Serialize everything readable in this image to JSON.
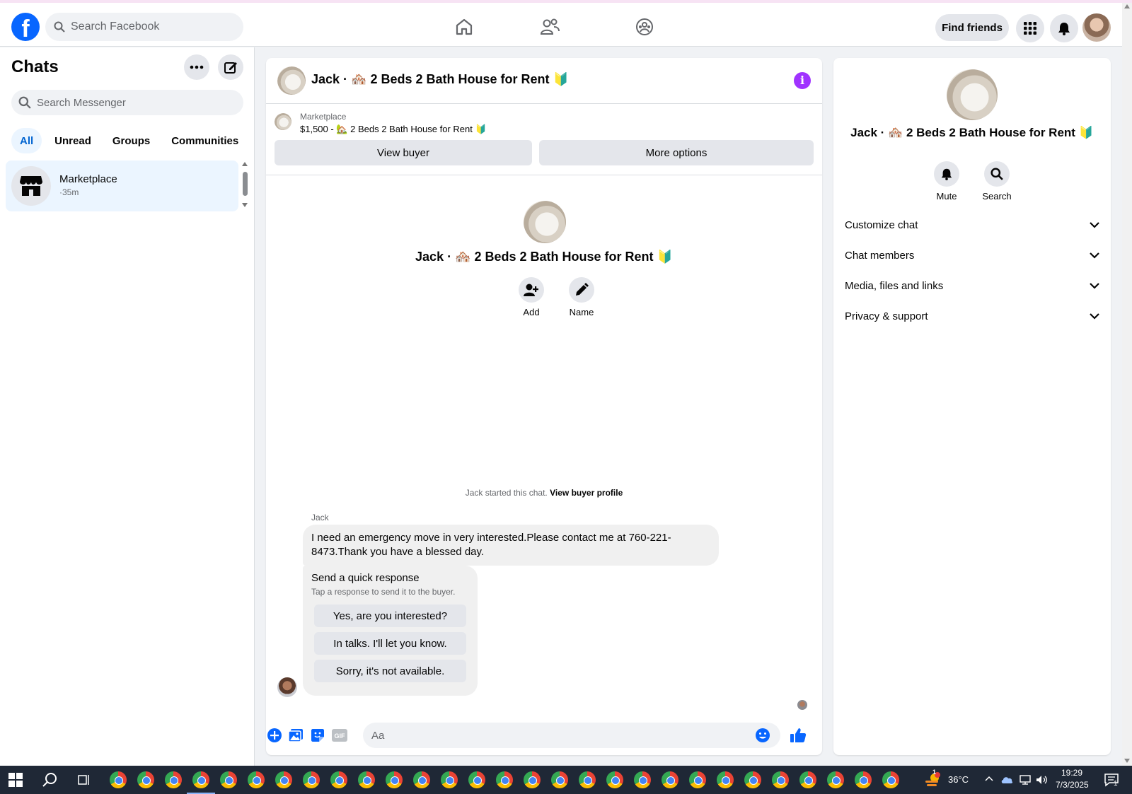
{
  "topbar": {
    "search_placeholder": "Search Facebook",
    "find_friends": "Find friends",
    "brand_color": "#0866ff"
  },
  "sidebar": {
    "title": "Chats",
    "search_placeholder": "Search Messenger",
    "filters": [
      "All",
      "Unread",
      "Groups",
      "Communities"
    ],
    "active_filter": "All",
    "chats": [
      {
        "name": "Marketplace",
        "time": "·35m",
        "icon": "store-icon"
      }
    ]
  },
  "chat": {
    "title": "Jack · 🏘️ 2 Beds 2 Bath House for Rent 🔰",
    "marketplace_label": "Marketplace",
    "listing": "$1,500 - 🏡 2 Beds 2 Bath House for Rent 🔰",
    "view_buyer": "View buyer",
    "more_options": "More options",
    "actions": [
      {
        "label": "Add",
        "icon": "add-person-icon"
      },
      {
        "label": "Name",
        "icon": "pencil-icon"
      }
    ],
    "started_text": "Jack started this chat. ",
    "started_link": "View buyer profile",
    "sender": "Jack",
    "message": "I need an emergency move in very interested.Please  contact me at 760-221-8473.Thank you have a blessed day.",
    "quick_title": "Send a quick response",
    "quick_subtitle": "Tap a response to send it to the buyer.",
    "quick_replies": [
      "Yes, are you interested?",
      "In talks. I'll let you know.",
      "Sorry, it's not available."
    ],
    "composer_placeholder": "Aa"
  },
  "details": {
    "title": "Jack · 🏘️ 2 Beds 2 Bath House for Rent 🔰",
    "actions": [
      {
        "label": "Mute",
        "icon": "bell-icon"
      },
      {
        "label": "Search",
        "icon": "search-icon"
      }
    ],
    "sections": [
      "Customize chat",
      "Chat members",
      "Media, files and links",
      "Privacy & support"
    ]
  },
  "taskbar": {
    "temperature": "36°C",
    "time": "19:29",
    "date": "7/3/2025",
    "notification_count": "1"
  }
}
